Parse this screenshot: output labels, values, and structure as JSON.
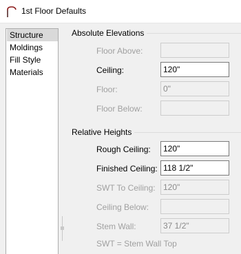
{
  "window": {
    "title": "1st Floor Defaults"
  },
  "icons": {
    "title": "arch-icon"
  },
  "nav": {
    "items": [
      {
        "label": "Structure",
        "selected": true
      },
      {
        "label": "Moldings",
        "selected": false
      },
      {
        "label": "Fill Style",
        "selected": false
      },
      {
        "label": "Materials",
        "selected": false
      }
    ]
  },
  "absolute_elevations": {
    "label": "Absolute Elevations",
    "fields": {
      "floor_above": {
        "label": "Floor Above:",
        "value": "",
        "enabled": false
      },
      "ceiling": {
        "label": "Ceiling:",
        "value": "120\"",
        "enabled": true
      },
      "floor": {
        "label": "Floor:",
        "value": "0\"",
        "enabled": false
      },
      "floor_below": {
        "label": "Floor Below:",
        "value": "",
        "enabled": false
      }
    }
  },
  "relative_heights": {
    "label": "Relative Heights",
    "fields": {
      "rough_ceiling": {
        "label": "Rough Ceiling:",
        "value": "120\"",
        "enabled": true
      },
      "finished_ceiling": {
        "label": "Finished Ceiling:",
        "value": "118 1/2\"",
        "enabled": true
      },
      "swt_to_ceiling": {
        "label": "SWT To Ceiling:",
        "value": "120\"",
        "enabled": false
      },
      "ceiling_below": {
        "label": "Ceiling Below:",
        "value": "",
        "enabled": false
      },
      "stem_wall": {
        "label": "Stem Wall:",
        "value": "37 1/2\"",
        "enabled": false
      }
    },
    "note": "SWT = Stem Wall Top"
  }
}
